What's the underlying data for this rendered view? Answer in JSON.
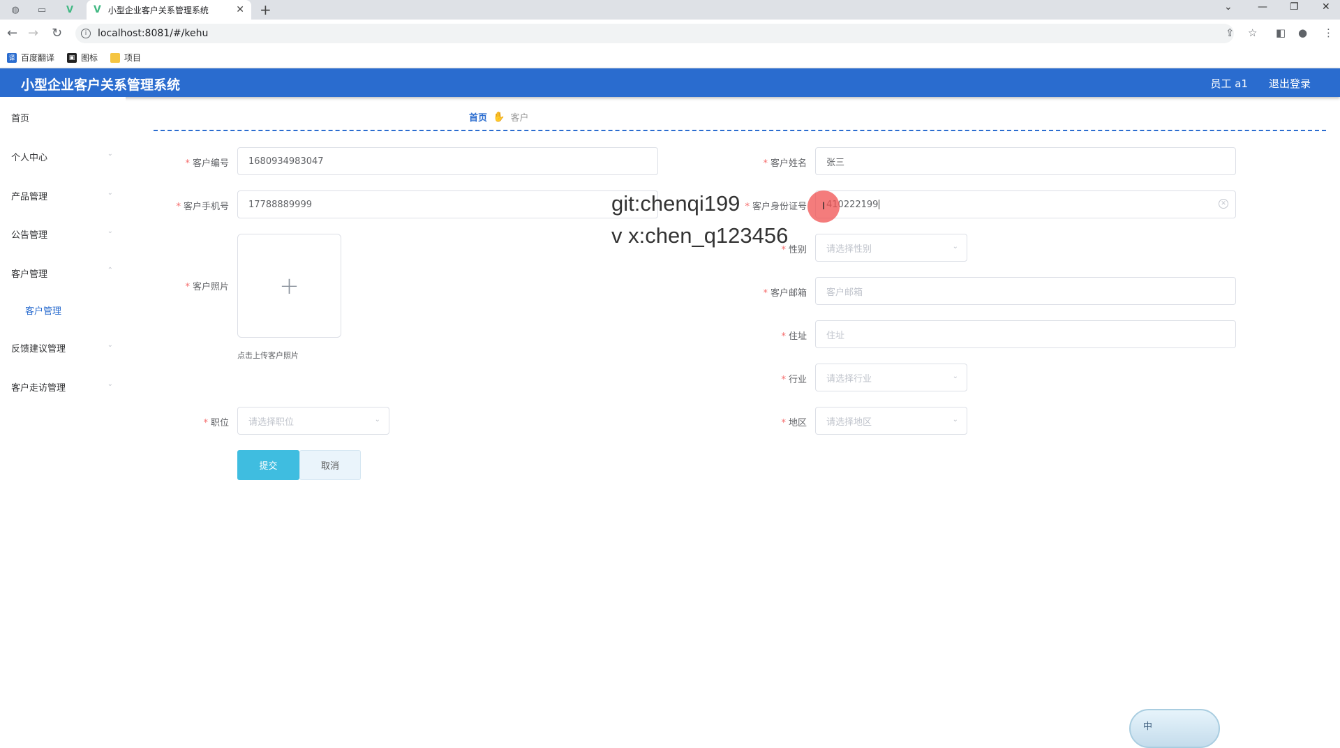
{
  "browser": {
    "tab_title": "小型企业客户关系管理系统",
    "url": "localhost:8081/#/kehu",
    "bookmarks": [
      {
        "label": "百度翻译",
        "color": "#2a6ccf",
        "icon": "translate-icon"
      },
      {
        "label": "图标",
        "color": "#222222",
        "icon": "image-icon"
      },
      {
        "label": "项目",
        "color": "#f5c542",
        "icon": "folder-icon"
      }
    ]
  },
  "header": {
    "title": "小型企业客户关系管理系统",
    "user": "员工 a1",
    "logout": "退出登录",
    "color": "#2a6ccf"
  },
  "sidebar": {
    "items": [
      {
        "label": "首页",
        "has_arrow": false
      },
      {
        "label": "个人中心",
        "has_arrow": true
      },
      {
        "label": "产品管理",
        "has_arrow": true
      },
      {
        "label": "公告管理",
        "has_arrow": true
      },
      {
        "label": "客户管理",
        "has_arrow": true,
        "expanded": true
      },
      {
        "label": "反馈建议管理",
        "has_arrow": true
      },
      {
        "label": "客户走访管理",
        "has_arrow": true
      }
    ],
    "sub_item": "客户管理"
  },
  "breadcrumb": {
    "home": "首页",
    "current": "客户"
  },
  "form": {
    "customer_no": {
      "label": "客户编号",
      "value": "1680934983047"
    },
    "customer_name": {
      "label": "客户姓名",
      "value": "张三"
    },
    "phone": {
      "label": "客户手机号",
      "value": "17788889999"
    },
    "id_card": {
      "label": "客户身份证号",
      "value": "410222199"
    },
    "photo": {
      "label": "客户照片",
      "tip": "点击上传客户照片",
      "plus": "+"
    },
    "gender": {
      "label": "性别",
      "placeholder": "请选择性别"
    },
    "email": {
      "label": "客户邮箱",
      "placeholder": "客户邮箱"
    },
    "address": {
      "label": "住址",
      "placeholder": "住址"
    },
    "industry": {
      "label": "行业",
      "placeholder": "请选择行业"
    },
    "position": {
      "label": "职位",
      "placeholder": "请选择职位"
    },
    "region": {
      "label": "地区",
      "placeholder": "请选择地区"
    },
    "submit": "提交",
    "cancel": "取消"
  },
  "watermark": {
    "line1": "git:chenqi199",
    "line2": "v x:chen_q123456"
  },
  "ime": {
    "label": "中"
  }
}
